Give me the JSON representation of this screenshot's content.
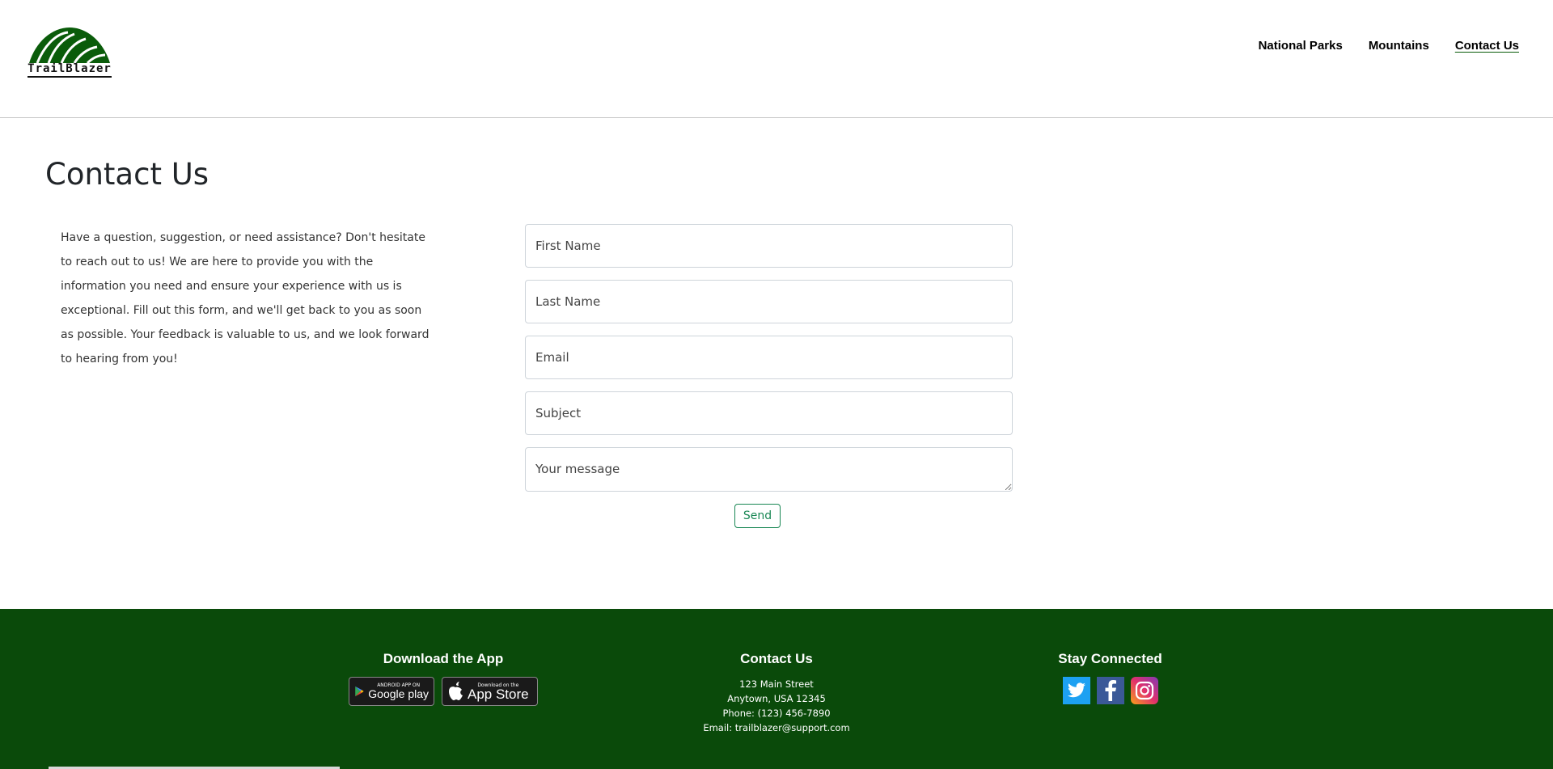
{
  "brand": {
    "name": "TrailBlazer",
    "logo_icon": "striped-hill-logo-icon",
    "color": "#0a5c0a"
  },
  "nav": {
    "items": [
      {
        "label": "National Parks",
        "active": false
      },
      {
        "label": "Mountains",
        "active": false
      },
      {
        "label": "Contact Us",
        "active": true
      }
    ]
  },
  "main": {
    "title": "Contact Us",
    "intro": "Have a question, suggestion, or need assistance? Don't hesitate to reach out to us! We are here to provide you with the information you need and ensure your experience with us is exceptional. Fill out this form, and we'll get back to you as soon as possible. Your feedback is valuable to us, and we look forward to hearing from you!"
  },
  "form": {
    "first_name": {
      "placeholder": "First Name",
      "value": ""
    },
    "last_name": {
      "placeholder": "Last Name",
      "value": ""
    },
    "email": {
      "placeholder": "Email",
      "value": ""
    },
    "subject": {
      "placeholder": "Subject",
      "value": ""
    },
    "message": {
      "placeholder": "Your message",
      "value": ""
    },
    "send_label": "Send",
    "send_color": "#198754"
  },
  "footer": {
    "background": "#0a4a0a",
    "app": {
      "heading": "Download the App",
      "google_small": "ANDROID APP ON",
      "google_big": "Google play",
      "apple_small": "Download on the",
      "apple_big": "App Store"
    },
    "contact": {
      "heading": "Contact Us",
      "address1": "123 Main Street",
      "address2": "Anytown, USA 12345",
      "phone": "Phone: (123) 456-7890",
      "email": "Email: trailblazer@support.com"
    },
    "social": {
      "heading": "Stay Connected",
      "icons": [
        "twitter-icon",
        "facebook-icon",
        "instagram-icon"
      ]
    }
  }
}
